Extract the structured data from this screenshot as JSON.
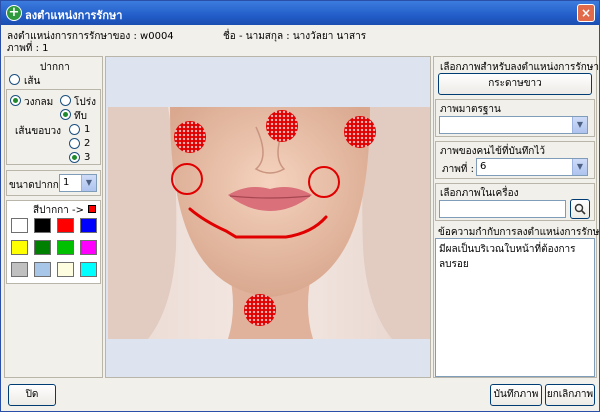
{
  "window": {
    "title": "ลงตำแหน่งการรักษา",
    "close_glyph": "×",
    "title_icon_glyph": "+"
  },
  "header": {
    "record_label": "ลงตำแหน่งการการรักษาของ : w0004",
    "patient_name": "ชื่อ - นามสกุล : นางวัลยา นาสาร",
    "image_number": "ภาพที่ : 1"
  },
  "pen": {
    "group_label": "ปากกา",
    "line_label": "เส้น",
    "circle_label": "วงกลม",
    "hollow_label": "โปร่ง",
    "solid_label": "ทึบ",
    "border_label": "เส้นขอบวง",
    "border_options": [
      "1",
      "2",
      "3"
    ],
    "border_selected": "3",
    "size_label": "ขนาดปากกา",
    "size_value": "1",
    "color_label": "สีปากกา ->"
  },
  "palette": {
    "colors": [
      "#ffffff",
      "#000000",
      "#ff0000",
      "#0000ff",
      "#ffff00",
      "#008000",
      "#00c000",
      "#ff00ff",
      "#c0c0c0",
      "#a8c6e8",
      "#fffde0",
      "#00ffff"
    ],
    "selected": "#ff0000"
  },
  "right": {
    "choose_label": "เลือกภาพสำหรับลงตำแหน่งการรักษา",
    "paper_button": "กระดาษขาว",
    "standard_label": "ภาพมาตรฐาน",
    "standard_value": "",
    "patient_images_label": "ภาพของคนไข้ที่บันทึกไว้",
    "image_no_label": "ภาพที่ :",
    "image_no_value": "6",
    "local_label": "เลือกภาพในเครื่อง",
    "local_value": "",
    "note_label": "ข้อความกำกับการลงตำแหน่งการรักษา",
    "note_text": "มีผลเป็นบริเวณใบหน้าที่ต้องการลบรอย"
  },
  "footer": {
    "close_button": "ปิด",
    "save_button": "บันทึกภาพ",
    "cancel_button": "ยกเลิกภาพ"
  },
  "colors": {
    "accent": "#e00000",
    "title_bar": "#225dc9"
  }
}
